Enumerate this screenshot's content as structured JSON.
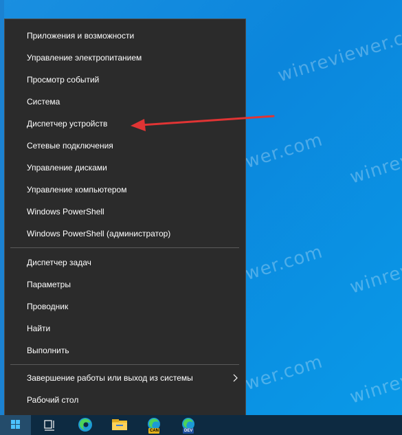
{
  "watermark": "winreviewer.com",
  "menu": {
    "group1": [
      "Приложения и возможности",
      "Управление электропитанием",
      "Просмотр событий",
      "Система",
      "Диспетчер устройств",
      "Сетевые подключения",
      "Управление дисками",
      "Управление компьютером",
      "Windows PowerShell",
      "Windows PowerShell (администратор)"
    ],
    "group2": [
      "Диспетчер задач",
      "Параметры",
      "Проводник",
      "Найти",
      "Выполнить"
    ],
    "shutdown": "Завершение работы или выход из системы",
    "desktop": "Рабочий стол"
  },
  "taskbar": {
    "icons": [
      "windows-start-icon",
      "task-view-icon",
      "edge-icon",
      "file-explorer-icon",
      "edge-canary-icon",
      "edge-dev-icon"
    ],
    "badges": {
      "canary": "CAN",
      "dev": "DEV"
    }
  },
  "colors": {
    "menu_bg": "#2b2b2b",
    "desktop": "#0b86dc",
    "taskbar": "#0d2a41",
    "arrow": "#e03434"
  }
}
